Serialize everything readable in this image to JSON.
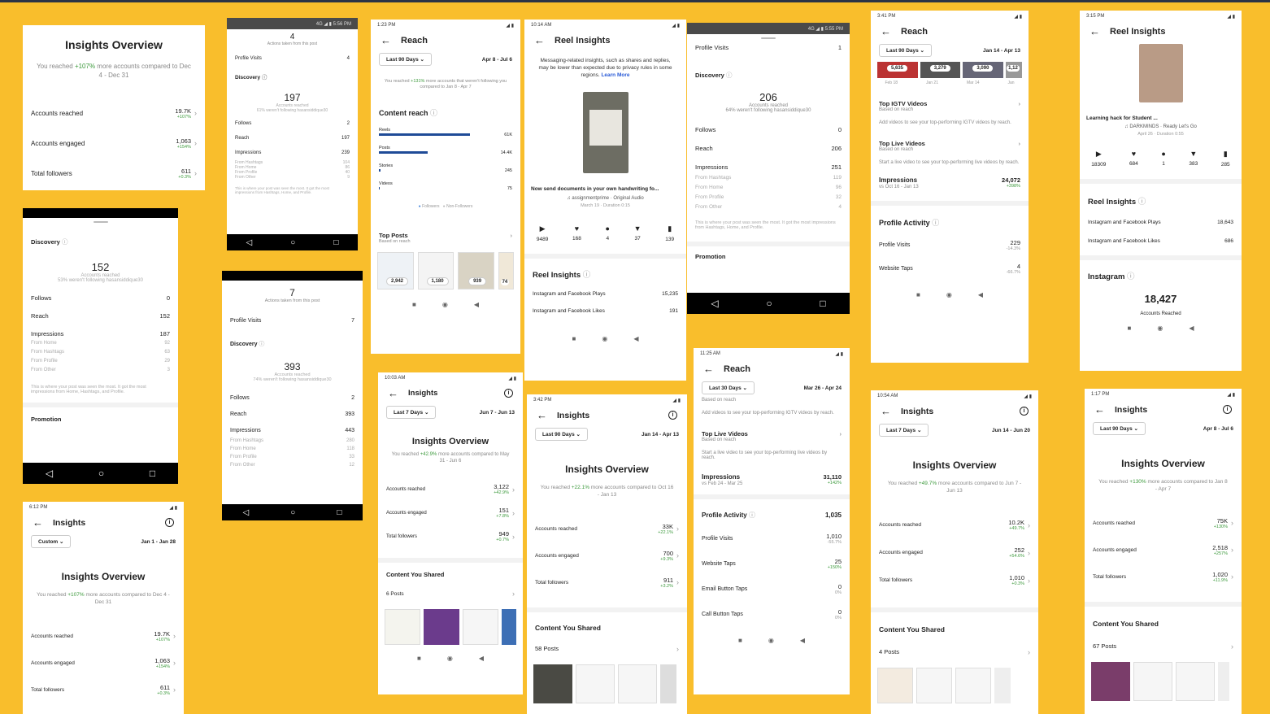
{
  "c1": {
    "title": "Insights Overview",
    "sub_pre": "You reached ",
    "sub_hl": "+107%",
    "sub_post": " more accounts compared to Dec 4 - Dec 31",
    "metrics": [
      {
        "label": "Accounts reached",
        "value": "19.7K",
        "delta": "+107%"
      },
      {
        "label": "Accounts engaged",
        "value": "1,063",
        "delta": "+154%"
      },
      {
        "label": "Total followers",
        "value": "611",
        "delta": "+0.3%"
      }
    ]
  },
  "c2": {
    "status_left": "",
    "status_right": "4G ◢ ▮ 5:56 PM",
    "top_num": "4",
    "top_caption": "Actions taken from this post",
    "profile_visits_label": "Profile Visits",
    "profile_visits": "4",
    "discovery": "Discovery",
    "reach_num": "197",
    "reach_cap": "Accounts reached",
    "reach_note": "61% weren't following hasansiddique30",
    "rows": [
      {
        "l": "Follows",
        "v": "2"
      },
      {
        "l": "Reach",
        "v": "197"
      },
      {
        "l": "Impressions",
        "v": "239"
      }
    ],
    "subrows": [
      {
        "l": "From Hashtags",
        "v": "104"
      },
      {
        "l": "From Home",
        "v": "86"
      },
      {
        "l": "From Profile",
        "v": "40"
      },
      {
        "l": "From Other",
        "v": "9"
      }
    ],
    "note": "This is where your post was seen the most. It got the most impressions from Hashtags, Home, and Profile."
  },
  "c3": {
    "time": "1:23 PM",
    "title": "Reach",
    "range": "Last 90 Days",
    "dates": "Apr 8 - Jul 6",
    "sub_pre": "You reached ",
    "sub_hl": "+131%",
    "sub_post": " more accounts that weren't following you compared to Jan 8 - Apr 7",
    "content_reach": "Content reach",
    "bars": [
      {
        "l": "Reels",
        "v": "61K"
      },
      {
        "l": "Posts",
        "v": "14.4K"
      },
      {
        "l": "Stories",
        "v": "245"
      },
      {
        "l": "Videos",
        "v": "75"
      }
    ],
    "legend_a": "Followers",
    "legend_b": "Non-Followers",
    "top_posts": "Top Posts",
    "top_posts_sub": "Based on reach",
    "thumbs": [
      "2,942",
      "1,180",
      "939",
      "74"
    ]
  },
  "c4": {
    "time": "10:14 AM",
    "title": "Reel Insights",
    "notice": "Messaging-related insights, such as shares and replies, may be lower than expected due to privacy rules in some regions.",
    "learn": "Learn More",
    "caption": "Now send documents in your own handwriting fo...",
    "audio": "assignmentprime · Original Audio",
    "meta": "March 19 · Duration 0:15",
    "stats": [
      "9489",
      "168",
      "4",
      "37",
      "139"
    ],
    "section": "Reel Insights",
    "rows": [
      {
        "l": "Instagram and Facebook Plays",
        "v": "15,235"
      },
      {
        "l": "Instagram and Facebook Likes",
        "v": "191"
      }
    ]
  },
  "c5": {
    "status_right": "4G ◢ ▮ 5:55 PM",
    "profile_visits_label": "Profile Visits",
    "profile_visits": "1",
    "discovery": "Discovery",
    "reach_num": "206",
    "reach_cap": "Accounts reached",
    "reach_note": "64% weren't following hasansiddique30",
    "rows": [
      {
        "l": "Follows",
        "v": "0"
      },
      {
        "l": "Reach",
        "v": "206"
      },
      {
        "l": "Impressions",
        "v": "251"
      }
    ],
    "subrows": [
      {
        "l": "From Hashtags",
        "v": "119"
      },
      {
        "l": "From Home",
        "v": "96"
      },
      {
        "l": "From Profile",
        "v": "32"
      },
      {
        "l": "From Other",
        "v": "4"
      }
    ],
    "note": "This is where your post was seen the most. It got the most impressions from Hashtags, Home, and Profile.",
    "promotion": "Promotion"
  },
  "c6": {
    "time": "3:41 PM",
    "title": "Reach",
    "range": "Last 90 Days",
    "dates": "Jan 14 - Apr 13",
    "thumbs": [
      "5,635",
      "3,279",
      "3,090",
      "1,12"
    ],
    "dates_row": [
      "Feb 18",
      "Jan 21",
      "Mar 14",
      "Jan"
    ],
    "igtv": "Top IGTV Videos",
    "igtv_sub": "Based on reach",
    "igtv_note": "Add videos to see your top-performing IGTV videos by reach.",
    "live": "Top Live Videos",
    "live_sub": "Based on reach",
    "live_note": "Start a live video to see your top-performing live videos by reach.",
    "imp": "Impressions",
    "imp_sub": "vs Oct 16 - Jan 13",
    "imp_v": "24,072",
    "imp_d": "+398%",
    "pa": "Profile Activity",
    "pa_rows": [
      {
        "l": "Profile Visits",
        "v": "229",
        "d": "-14.3%"
      },
      {
        "l": "Website Taps",
        "v": "4",
        "d": "-66.7%"
      }
    ]
  },
  "c7": {
    "time": "3:15 PM",
    "title": "Reel Insights",
    "caption": "Learning hack for Student ...",
    "audio": "DARKMINDS · Ready Let's Go",
    "meta": "April 26 · Duration 0:55",
    "stats": [
      "18309",
      "684",
      "1",
      "383",
      "285"
    ],
    "section": "Reel Insights",
    "rows": [
      {
        "l": "Instagram and Facebook Plays",
        "v": "18,643"
      },
      {
        "l": "Instagram and Facebook Likes",
        "v": "686"
      }
    ],
    "ig": "Instagram",
    "ig_num": "18,427",
    "ig_cap": "Accounts Reached"
  },
  "c8": {
    "discovery": "Discovery",
    "reach_num": "152",
    "reach_cap": "Accounts reached",
    "reach_note": "53% weren't following hasansiddique30",
    "rows": [
      {
        "l": "Follows",
        "v": "0"
      },
      {
        "l": "Reach",
        "v": "152"
      },
      {
        "l": "Impressions",
        "v": "187"
      }
    ],
    "subrows": [
      {
        "l": "From Home",
        "v": "92"
      },
      {
        "l": "From Hashtags",
        "v": "63"
      },
      {
        "l": "From Profile",
        "v": "29"
      },
      {
        "l": "From Other",
        "v": "3"
      }
    ],
    "note": "This is where your post was seen the most. It got the most impressions from Home, Hashtags, and Profile.",
    "promotion": "Promotion"
  },
  "c9": {
    "top_num": "7",
    "top_caption": "Actions taken from this post",
    "profile_visits_label": "Profile Visits",
    "profile_visits": "7",
    "discovery": "Discovery",
    "reach_num": "393",
    "reach_cap": "Accounts reached",
    "reach_note": "74% weren't following hasansiddique30",
    "rows": [
      {
        "l": "Follows",
        "v": "2"
      },
      {
        "l": "Reach",
        "v": "393"
      },
      {
        "l": "Impressions",
        "v": "443"
      }
    ],
    "subrows": [
      {
        "l": "From Hashtags",
        "v": "280"
      },
      {
        "l": "From Home",
        "v": "118"
      },
      {
        "l": "From Profile",
        "v": "33"
      },
      {
        "l": "From Other",
        "v": "12"
      }
    ]
  },
  "c10": {
    "time": "10:03 AM",
    "title": "Insights",
    "range": "Last 7 Days",
    "dates": "Jun 7 - Jun 13",
    "ov": "Insights Overview",
    "sub_pre": "You reached ",
    "sub_hl": "+42.9%",
    "sub_post": " more accounts compared to May 31 - Jun 6",
    "metrics": [
      {
        "label": "Accounts reached",
        "value": "3,122",
        "delta": "+42.9%"
      },
      {
        "label": "Accounts engaged",
        "value": "151",
        "delta": "+7.8%"
      },
      {
        "label": "Total followers",
        "value": "949",
        "delta": "+0.7%"
      }
    ],
    "cys": "Content You Shared",
    "posts": "6 Posts"
  },
  "c11": {
    "time": "3:42 PM",
    "title": "Insights",
    "range": "Last 90 Days",
    "dates": "Jan 14 - Apr 13",
    "ov": "Insights Overview",
    "sub_pre": "You reached ",
    "sub_hl": "+22.1%",
    "sub_post": " more accounts compared to Oct 16 - Jan 13",
    "metrics": [
      {
        "label": "Accounts reached",
        "value": "33K",
        "delta": "+22.1%"
      },
      {
        "label": "Accounts engaged",
        "value": "700",
        "delta": "+9.3%"
      },
      {
        "label": "Total followers",
        "value": "911",
        "delta": "+3.2%"
      }
    ],
    "cys": "Content You Shared",
    "posts": "58 Posts"
  },
  "c12": {
    "time": "11:25 AM",
    "title": "Reach",
    "range": "Last 30 Days",
    "dates": "Mar 26 - Apr 24",
    "based": "Based on reach",
    "igtv_note": "Add videos to see your top-performing IGTV videos by reach.",
    "live": "Top Live Videos",
    "live_sub": "Based on reach",
    "live_note": "Start a live video to see your top-performing live videos by reach.",
    "imp": "Impressions",
    "imp_sub": "vs Feb 24 - Mar 25",
    "imp_v": "31,110",
    "imp_d": "+142%",
    "pa": "Profile Activity",
    "pa_v": "1,035",
    "pa_rows": [
      {
        "l": "Profile Visits",
        "v": "1,010",
        "d": "-55.7%"
      },
      {
        "l": "Website Taps",
        "v": "25",
        "d": "+150%"
      },
      {
        "l": "Email Button Taps",
        "v": "0",
        "d": "0%"
      },
      {
        "l": "Call Button Taps",
        "v": "0",
        "d": "0%"
      }
    ]
  },
  "c13": {
    "time": "10:54 AM",
    "title": "Insights",
    "range": "Last 7 Days",
    "dates": "Jun 14 - Jun 20",
    "ov": "Insights Overview",
    "sub_pre": "You reached ",
    "sub_hl": "+49.7%",
    "sub_post": " more accounts compared to Jun 7 - Jun 13",
    "metrics": [
      {
        "label": "Accounts reached",
        "value": "10.2K",
        "delta": "+49.7%"
      },
      {
        "label": "Accounts engaged",
        "value": "252",
        "delta": "+54.6%"
      },
      {
        "label": "Total followers",
        "value": "1,010",
        "delta": "+0.3%"
      }
    ],
    "cys": "Content You Shared",
    "posts": "4 Posts"
  },
  "c14": {
    "time": "1:17 PM",
    "title": "Insights",
    "range": "Last 90 Days",
    "dates": "Apr 8 - Jul 6",
    "ov": "Insights Overview",
    "sub_pre": "You reached ",
    "sub_hl": "+130%",
    "sub_post": " more accounts compared to Jan 8 - Apr 7",
    "metrics": [
      {
        "label": "Accounts reached",
        "value": "75K",
        "delta": "+130%"
      },
      {
        "label": "Accounts engaged",
        "value": "2,518",
        "delta": "+257%"
      },
      {
        "label": "Total followers",
        "value": "1,020",
        "delta": "+11.9%"
      }
    ],
    "cys": "Content You Shared",
    "posts": "67 Posts"
  },
  "c15": {
    "time": "6:12 PM",
    "title": "Insights",
    "range": "Custom",
    "dates": "Jan 1 - Jan 28",
    "ov": "Insights Overview",
    "sub_pre": "You reached ",
    "sub_hl": "+107%",
    "sub_post": " more accounts compared to Dec 4 - Dec 31",
    "metrics": [
      {
        "label": "Accounts reached",
        "value": "19.7K",
        "delta": "+107%"
      },
      {
        "label": "Accounts engaged",
        "value": "1,063",
        "delta": "+154%"
      },
      {
        "label": "Total followers",
        "value": "611",
        "delta": "+0.3%"
      }
    ]
  }
}
